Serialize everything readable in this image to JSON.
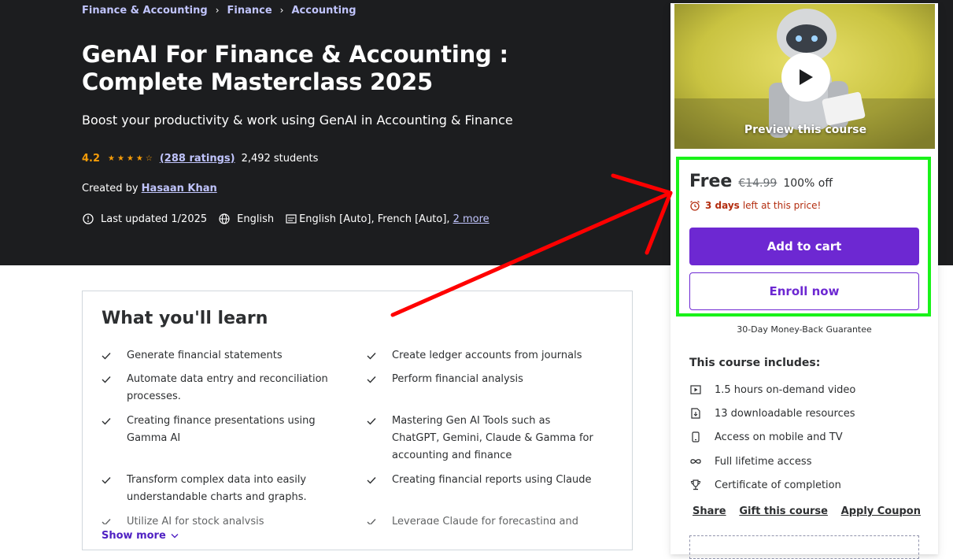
{
  "breadcrumb": [
    "Finance & Accounting",
    "Finance",
    "Accounting"
  ],
  "course": {
    "title": "GenAI For Finance & Accounting : Complete Masterclass 2025",
    "subtitle": "Boost your productivity & work using GenAI in Accounting & Finance",
    "rating": "4.2",
    "ratings_count": "(288 ratings)",
    "students": "2,492 students",
    "created_by_label": "Created by",
    "instructor": "Hasaan Khan",
    "last_updated": "Last updated 1/2025",
    "language": "English",
    "captions": "English [Auto], French [Auto],",
    "more_captions": "2 more"
  },
  "learn": {
    "title": "What you'll learn",
    "items": [
      "Generate financial statements",
      "Create ledger accounts from journals",
      "Automate data entry and reconciliation processes.",
      "Perform financial analysis",
      "Creating finance presentations using Gamma AI",
      "Mastering Gen AI Tools such as ChatGPT, Gemini, Claude & Gamma for accounting and finance",
      "Transform complex data into easily understandable charts and graphs.",
      "Creating financial reports using Claude",
      "Utilize AI for stock analysis",
      "Leverage Claude for forecasting and"
    ],
    "show_more": "Show more"
  },
  "sidebar": {
    "preview_label": "Preview this course",
    "price": "Free",
    "original_price": "€14.99",
    "discount": "100% off",
    "timer_days": "3 days",
    "timer_text": "left at this price!",
    "add_to_cart": "Add to cart",
    "enroll_now": "Enroll now",
    "guarantee": "30-Day Money-Back Guarantee",
    "includes_title": "This course includes:",
    "includes": [
      {
        "icon": "video-icon",
        "text": "1.5 hours on-demand video"
      },
      {
        "icon": "download-file-icon",
        "text": "13 downloadable resources"
      },
      {
        "icon": "mobile-icon",
        "text": "Access on mobile and TV"
      },
      {
        "icon": "infinity-icon",
        "text": "Full lifetime access"
      },
      {
        "icon": "trophy-icon",
        "text": "Certificate of completion"
      }
    ],
    "share": "Share",
    "gift": "Gift this course",
    "coupon": "Apply Coupon"
  },
  "colors": {
    "accent": "#6d28d2",
    "rating": "#f69c08",
    "highlight": "#19f219",
    "arrow": "#ff0000"
  }
}
